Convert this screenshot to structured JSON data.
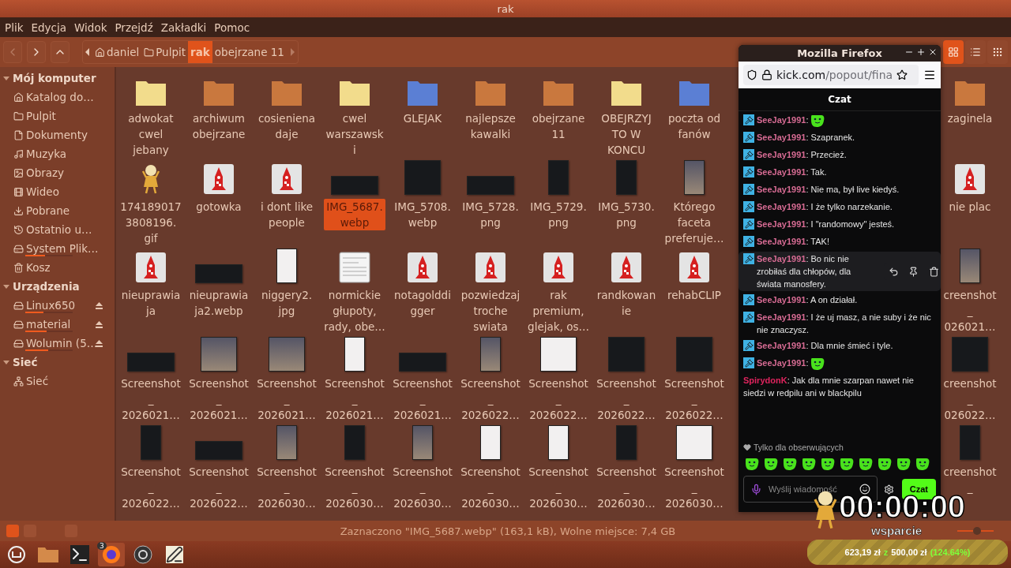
{
  "window": {
    "title": "rak"
  },
  "menu": [
    "Plik",
    "Edycja",
    "Widok",
    "Przejdź",
    "Zakładki",
    "Pomoc"
  ],
  "nav": {
    "back_disabled": true,
    "forward_disabled": false,
    "up_disabled": false
  },
  "breadcrumb": [
    {
      "label": "daniel",
      "selected": false
    },
    {
      "label": "Pulpit",
      "selected": false
    },
    {
      "label": "rak",
      "selected": true
    },
    {
      "label": "obejrzane 11",
      "selected": false
    }
  ],
  "view_buttons": [
    {
      "selected": true
    },
    {
      "selected": false
    },
    {
      "selected": false
    }
  ],
  "sidebar": [
    {
      "title": "Mój komputer",
      "expanded": true,
      "items": [
        {
          "label": "Katalog do…"
        },
        {
          "label": "Pulpit"
        },
        {
          "label": "Dokumenty"
        },
        {
          "label": "Muzyka"
        },
        {
          "label": "Obrazy"
        },
        {
          "label": "Wideo"
        },
        {
          "label": "Pobrane"
        },
        {
          "label": "Ostatnio u…"
        },
        {
          "label": "System Plik…",
          "level": 0.42
        },
        {
          "label": "Kosz"
        }
      ]
    },
    {
      "title": "Urządzenia",
      "expanded": true,
      "items": [
        {
          "label": "Linux650",
          "level": 0.38,
          "mounted": true
        },
        {
          "label": "material",
          "level": 0.45,
          "mounted": true
        },
        {
          "label": "Wolumin (5…",
          "level": 0.48,
          "mounted": true
        }
      ]
    },
    {
      "title": "Sieć",
      "expanded": true,
      "items": [
        {
          "label": "Sieć"
        }
      ]
    }
  ],
  "rows": [
    {
      "items": [
        {
          "lines": [
            "adwokat",
            "cwel",
            "jebany"
          ],
          "kind": "folder",
          "color": "#f2dc8c",
          "selected": false
        },
        {
          "lines": [
            "archiwum",
            "obejrzane"
          ],
          "kind": "folder",
          "color": "#c9783e",
          "selected": false
        },
        {
          "lines": [
            "cosieniena",
            "daje"
          ],
          "kind": "folder",
          "color": "#c9783e",
          "selected": false
        },
        {
          "lines": [
            "cwel",
            "warszawsk",
            "i"
          ],
          "kind": "folder",
          "color": "#f2dc8c",
          "selected": false
        },
        {
          "lines": [
            "GLEJAK"
          ],
          "kind": "folder",
          "color": "#5b7fd4",
          "selected": false
        },
        {
          "lines": [
            "najlepsze",
            "kawalki"
          ],
          "kind": "folder",
          "color": "#c9783e",
          "selected": false
        },
        {
          "lines": [
            "obejrzane",
            "11"
          ],
          "kind": "folder",
          "color": "#c9783e",
          "selected": false
        },
        {
          "lines": [
            "OBEJRZYJ",
            "TO W",
            "KONCU"
          ],
          "kind": "folder",
          "color": "#f2dc8c",
          "selected": false
        },
        {
          "lines": [
            "poczta od",
            "fanów"
          ],
          "kind": "folder",
          "color": "#5b7fd4",
          "selected": false
        }
      ],
      "edge": {
        "lines": [
          "zaginela"
        ],
        "kind": "folder",
        "color": "#c9783e",
        "selected": false
      }
    },
    {
      "items": [
        {
          "lines": [
            "174189017",
            "3808196.",
            "gif"
          ],
          "kind": "sprite",
          "selected": false
        },
        {
          "lines": [
            "gotowka"
          ],
          "kind": "rocket",
          "selected": false
        },
        {
          "lines": [
            "i dont like",
            "people"
          ],
          "kind": "rocket",
          "selected": false
        },
        {
          "lines": [
            "IMG_5687.",
            "webp"
          ],
          "kind": "banner",
          "selected": true
        },
        {
          "lines": [
            "IMG_5708.",
            "webp"
          ],
          "kind": "screen",
          "selected": false
        },
        {
          "lines": [
            "IMG_5728.",
            "png"
          ],
          "kind": "banner",
          "selected": false
        },
        {
          "lines": [
            "IMG_5729.",
            "png"
          ],
          "kind": "phone",
          "selected": false
        },
        {
          "lines": [
            "IMG_5730.",
            "png"
          ],
          "kind": "phone",
          "selected": false
        },
        {
          "lines": [
            "Którego",
            "faceta",
            "preferuje…"
          ],
          "kind": "portrait",
          "selected": false
        }
      ],
      "edge": {
        "lines": [
          "nie plac"
        ],
        "kind": "rocket",
        "selected": false
      }
    },
    {
      "items": [
        {
          "lines": [
            "nieuprawia",
            "ja"
          ],
          "kind": "rocket",
          "selected": false
        },
        {
          "lines": [
            "nieuprawia",
            "ja2.webp"
          ],
          "kind": "banner",
          "selected": false
        },
        {
          "lines": [
            "niggery2.",
            "jpg"
          ],
          "kind": "page",
          "selected": false
        },
        {
          "lines": [
            "normickie",
            "głupoty,",
            "rady, obe…"
          ],
          "kind": "doc",
          "selected": false
        },
        {
          "lines": [
            "notagolddi",
            "gger"
          ],
          "kind": "rocket",
          "selected": false
        },
        {
          "lines": [
            "pozwiedzaj",
            "troche",
            "swiata"
          ],
          "kind": "rocket",
          "selected": false
        },
        {
          "lines": [
            "rak",
            "premium,",
            "glejak, os…"
          ],
          "kind": "rocket",
          "selected": false
        },
        {
          "lines": [
            "randkowan",
            "ie"
          ],
          "kind": "rocket",
          "selected": false
        },
        {
          "lines": [
            "rehabCLIP"
          ],
          "kind": "rocket",
          "selected": false
        }
      ],
      "edge": {
        "lines": [
          "creenshot",
          "_",
          "026021…"
        ],
        "kind": "portrait",
        "selected": false
      }
    },
    {
      "items": [
        {
          "lines": [
            "Screenshot",
            "_",
            "2026021…"
          ],
          "kind": "banner",
          "selected": false
        },
        {
          "lines": [
            "Screenshot",
            "_",
            "2026021…"
          ],
          "kind": "picture",
          "selected": false
        },
        {
          "lines": [
            "Screenshot",
            "_",
            "2026021…"
          ],
          "kind": "picture",
          "selected": false
        },
        {
          "lines": [
            "Screenshot",
            "_",
            "2026021…"
          ],
          "kind": "page",
          "selected": false
        },
        {
          "lines": [
            "Screenshot",
            "_",
            "2026021…"
          ],
          "kind": "banner",
          "selected": false
        },
        {
          "lines": [
            "Screenshot",
            "_",
            "2026022…"
          ],
          "kind": "portrait",
          "selected": false
        },
        {
          "lines": [
            "Screenshot",
            "_",
            "2026022…"
          ],
          "kind": "card",
          "selected": false
        },
        {
          "lines": [
            "Screenshot",
            "_",
            "2026022…"
          ],
          "kind": "screen",
          "selected": false
        },
        {
          "lines": [
            "Screenshot",
            "_",
            "2026022…"
          ],
          "kind": "screen",
          "selected": false
        }
      ],
      "edge": {
        "lines": [
          "creenshot",
          "_",
          "026022…"
        ],
        "kind": "screen",
        "selected": false
      }
    },
    {
      "items": [
        {
          "lines": [
            "Screenshot",
            "_",
            "2026022…"
          ],
          "kind": "phone",
          "selected": false
        },
        {
          "lines": [
            "Screenshot",
            "_",
            "2026022…"
          ],
          "kind": "banner",
          "selected": false
        },
        {
          "lines": [
            "Screenshot",
            "_",
            "2026030…"
          ],
          "kind": "portrait",
          "selected": false
        },
        {
          "lines": [
            "Screenshot",
            "_",
            "2026030…"
          ],
          "kind": "phone",
          "selected": false
        },
        {
          "lines": [
            "Screenshot",
            "_",
            "2026030…"
          ],
          "kind": "portrait",
          "selected": false
        },
        {
          "lines": [
            "Screenshot",
            "_",
            "2026030…"
          ],
          "kind": "page",
          "selected": false
        },
        {
          "lines": [
            "Screenshot",
            "_",
            "2026030…"
          ],
          "kind": "page",
          "selected": false
        },
        {
          "lines": [
            "Screenshot",
            "_",
            "2026030…"
          ],
          "kind": "phone",
          "selected": false
        },
        {
          "lines": [
            "Screenshot",
            "_",
            "2026030…"
          ],
          "kind": "card",
          "selected": false
        }
      ],
      "edge": {
        "lines": [
          "creenshot",
          "_"
        ],
        "kind": "phone",
        "selected": false
      }
    }
  ],
  "status_bar": {
    "text": "Zaznaczono \"IMG_5687.webp\" (163,1 kB), Wolne miejsce: 7,4 GB",
    "zoom": {
      "level": 0.55
    }
  },
  "browser": {
    "title": "Mozilla Firefox",
    "url_host": "kick.com",
    "url_path": "/popout/fina",
    "chat_title": "Czat",
    "messages": [
      {
        "user": "SeeJay1991",
        "color": "#d66b93",
        "badge": true,
        "kind": "emote",
        "text": ":",
        "hovered": false
      },
      {
        "user": "SeeJay1991",
        "color": "#d66b93",
        "badge": true,
        "kind": "text",
        "text": ": Szapranek.",
        "hovered": false
      },
      {
        "user": "SeeJay1991",
        "color": "#d66b93",
        "badge": true,
        "kind": "text",
        "text": ": Przecież.",
        "hovered": false
      },
      {
        "user": "SeeJay1991",
        "color": "#d66b93",
        "badge": true,
        "kind": "text",
        "text": ": Tak.",
        "hovered": false
      },
      {
        "user": "SeeJay1991",
        "color": "#d66b93",
        "badge": true,
        "kind": "text",
        "text": ": Nie ma, był live kiedyś.",
        "hovered": false
      },
      {
        "user": "SeeJay1991",
        "color": "#d66b93",
        "badge": true,
        "kind": "text",
        "text": ": I że tylko narzekanie.",
        "hovered": false
      },
      {
        "user": "SeeJay1991",
        "color": "#d66b93",
        "badge": true,
        "kind": "text",
        "text": ": I \"randomowy\" jesteś.",
        "hovered": false
      },
      {
        "user": "SeeJay1991",
        "color": "#d66b93",
        "badge": true,
        "kind": "text",
        "text": ": TAK!",
        "hovered": false
      },
      {
        "user": "SeeJay1991",
        "color": "#d66b93",
        "badge": true,
        "kind": "text",
        "text": ": Bo nic nie zrobiłaś dla chłopów, dla świata manosfery.",
        "hovered": true
      },
      {
        "user": "SeeJay1991",
        "color": "#d66b93",
        "badge": true,
        "kind": "text",
        "text": ": A on działał.",
        "hovered": false
      },
      {
        "user": "SeeJay1991",
        "color": "#d66b93",
        "badge": true,
        "kind": "text",
        "text": ": I że uj masz, a nie suby i że nic nie znaczysz.",
        "hovered": false
      },
      {
        "user": "SeeJay1991",
        "color": "#d66b93",
        "badge": true,
        "kind": "text",
        "text": ": Dla mnie śmieć i tyle.",
        "hovered": false
      },
      {
        "user": "SeeJay1991",
        "color": "#d66b93",
        "badge": true,
        "kind": "emote",
        "text": ":",
        "hovered": false
      },
      {
        "user": "SpirydonK",
        "color": "#e0245e",
        "badge": false,
        "kind": "text",
        "text": ": Jak dla mnie szarpan nawet nie siedzi w redpilu ani w blackpilu",
        "hovered": false
      }
    ],
    "followers_only": "Tylko dla obserwujących",
    "input_placeholder": "Wyślij wiadomość",
    "send_label": "Czat"
  },
  "overlay": {
    "timer": "00:00:00",
    "caption": "wsparcie",
    "raised": "623,19 zł",
    "separator": "z",
    "goal": "500,00 zł",
    "percent": "(124.64%)",
    "level": 1
  },
  "taskbar": {
    "firefox_badge": "3"
  }
}
